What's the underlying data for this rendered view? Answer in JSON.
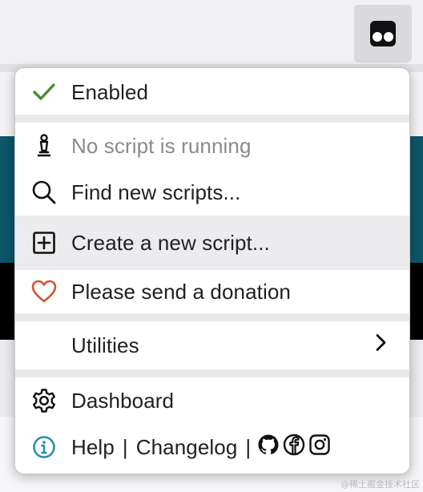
{
  "menu": {
    "enabled": "Enabled",
    "no_script": "No script is running",
    "find_scripts": "Find new scripts...",
    "create_script": "Create a new script...",
    "donation": "Please send a donation",
    "utilities": "Utilities",
    "dashboard": "Dashboard",
    "help": "Help",
    "separator": "|",
    "changelog": "Changelog"
  },
  "icons": {
    "enabled": "check-icon",
    "no_script": "chess-pawn-icon",
    "find": "search-icon",
    "create": "plus-square-icon",
    "donation": "heart-icon",
    "utilities": "chevron-right-icon",
    "dashboard": "gear-icon",
    "help": "info-icon",
    "github": "github-icon",
    "facebook": "facebook-icon",
    "instagram": "instagram-icon"
  },
  "colors": {
    "check": "#4a8c2a",
    "heart": "#d0542c",
    "info": "#2f8fa8",
    "teal_bg": "#0c5667"
  },
  "watermark": "@稀土掘金技术社区"
}
